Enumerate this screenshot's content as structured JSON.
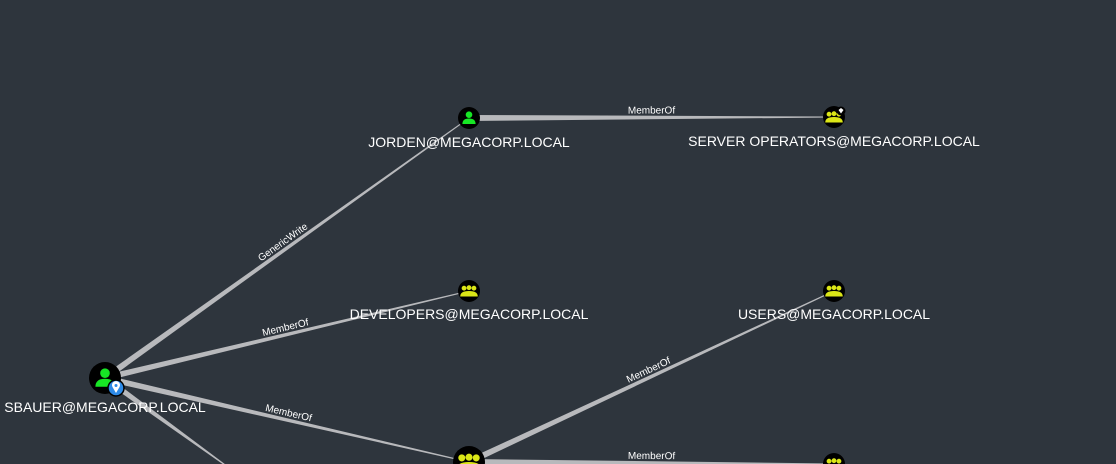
{
  "graph": {
    "nodes": [
      {
        "id": "sbauer",
        "label": "SBAUER@MEGACORP.LOCAL",
        "type": "user",
        "owned": true
      },
      {
        "id": "jorden",
        "label": "JORDEN@MEGACORP.LOCAL",
        "type": "user"
      },
      {
        "id": "serverops",
        "label": "SERVER OPERATORS@MEGACORP.LOCAL",
        "type": "group",
        "highvalue": true
      },
      {
        "id": "developers",
        "label": "DEVELOPERS@MEGACORP.LOCAL",
        "type": "group"
      },
      {
        "id": "users",
        "label": "USERS@MEGACORP.LOCAL",
        "type": "group"
      },
      {
        "id": "group_bottom",
        "label": "",
        "type": "group"
      },
      {
        "id": "group_bottom_right",
        "label": "",
        "type": "group"
      }
    ],
    "edges": [
      {
        "from": "sbauer",
        "to": "jorden",
        "label": "GenericWrite"
      },
      {
        "from": "jorden",
        "to": "serverops",
        "label": "MemberOf"
      },
      {
        "from": "sbauer",
        "to": "developers",
        "label": "MemberOf"
      },
      {
        "from": "sbauer",
        "to": "group_bottom",
        "label": "MemberOf"
      },
      {
        "from": "group_bottom",
        "to": "users",
        "label": "MemberOf"
      },
      {
        "from": "group_bottom",
        "to": "group_bottom_right",
        "label": "MemberOf"
      },
      {
        "from": "sbauer",
        "to": "offscreen",
        "label": ""
      }
    ]
  },
  "colors": {
    "background": "#2e353d",
    "user": "#17e625",
    "group": "#dbe617",
    "edge": "#b8b9bc",
    "owned_badge": "#2d8ae8"
  }
}
